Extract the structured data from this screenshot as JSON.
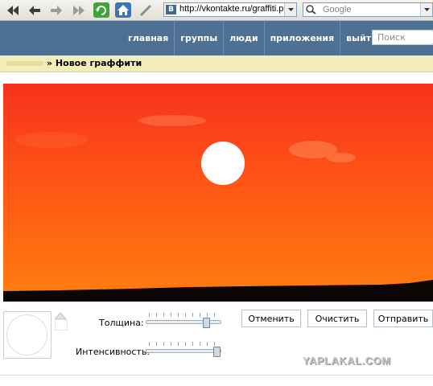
{
  "browser": {
    "url": "http://vkontakte.ru/graffiti.ph",
    "site_badge": "B",
    "search_placeholder": "Google"
  },
  "header": {
    "nav": [
      "главная",
      "группы",
      "люди",
      "приложения",
      "выйти"
    ],
    "search_placeholder": "Поиск"
  },
  "breadcrumb": {
    "current": "» Новое граффити"
  },
  "controls": {
    "thickness_label": "Толщина:",
    "thickness_value": 0.85,
    "intensity_label": "Интенсивность:",
    "intensity_value": 1.0,
    "cancel_label": "Отменить",
    "clear_label": "Очистить",
    "send_label": "Отправить",
    "brush_color": "#ffffff"
  },
  "watermark": "YAPLAKAL.COM",
  "colors": {
    "header_bg": "#4e7193",
    "sky_top": "#f7311c",
    "sky_bottom": "#ff7e0f",
    "sun": "#ffffff",
    "ground": "#0c0604"
  }
}
